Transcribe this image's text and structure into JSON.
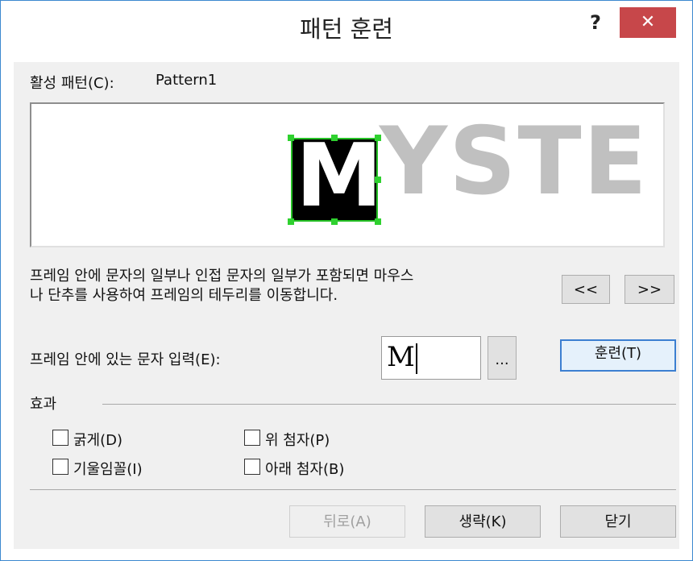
{
  "dialog": {
    "title": "패턴 훈련",
    "help_label": "?",
    "close_label": "✕"
  },
  "active_pattern": {
    "label": "활성 패턴(C):",
    "value": "Pattern1"
  },
  "preview": {
    "selected_char": "M",
    "following_text": "YSTE",
    "frame_color": "#26c126",
    "text_color": "#c0c0c0"
  },
  "instructions": "프레임 안에 문자의 일부나 인접 문자의 일부가 포함되면 마우스\n나 단추를 사용하여 프레임의 테두리를 이동합니다.",
  "nav": {
    "prev_label": "<<",
    "next_label": ">>"
  },
  "char_input": {
    "label": "프레임 안에 있는 문자 입력(E):",
    "value": "M",
    "browse_label": "...",
    "train_label": "훈련(T)"
  },
  "effects": {
    "label": "효과",
    "bold": {
      "label": "굵게(D)",
      "checked": false
    },
    "italic": {
      "label": "기울임꼴(I)",
      "checked": false
    },
    "superscript": {
      "label": "위 첨자(P)",
      "checked": false
    },
    "subscript": {
      "label": "아래 첨자(B)",
      "checked": false
    }
  },
  "footer": {
    "back_label": "뒤로(A)",
    "skip_label": "생략(K)",
    "close_label": "닫기"
  }
}
